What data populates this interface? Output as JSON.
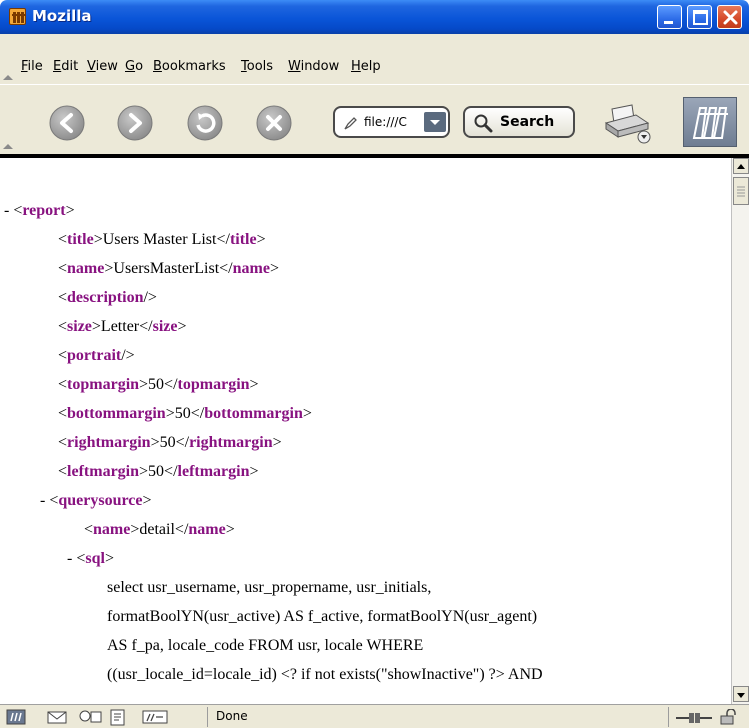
{
  "window": {
    "title": "Mozilla"
  },
  "menu": {
    "items": [
      {
        "pre": "",
        "acc": "F",
        "post": "ile"
      },
      {
        "pre": "",
        "acc": "E",
        "post": "dit"
      },
      {
        "pre": "",
        "acc": "V",
        "post": "iew"
      },
      {
        "pre": "",
        "acc": "G",
        "post": "o"
      },
      {
        "pre": "",
        "acc": "B",
        "post": "ookmarks"
      },
      {
        "pre": "",
        "acc": "T",
        "post": "ools"
      },
      {
        "pre": "",
        "acc": "W",
        "post": "indow"
      },
      {
        "pre": "",
        "acc": "H",
        "post": "elp"
      }
    ]
  },
  "toolbar": {
    "url_text": "file:///C",
    "search_label": "Search",
    "icons": [
      "back-icon",
      "forward-icon",
      "reload-icon",
      "stop-icon",
      "print-icon",
      "throbber-icon"
    ]
  },
  "content": {
    "lines": [
      {
        "parts": [
          {
            "t": "- <",
            "c": false
          },
          {
            "t": "report",
            "c": true
          },
          {
            "t": ">",
            "c": false
          }
        ]
      },
      {
        "parts": [
          {
            "t": "<",
            "c": false
          },
          {
            "t": "title",
            "c": true
          },
          {
            "t": ">Users Master List</",
            "c": false
          },
          {
            "t": "title",
            "c": true
          },
          {
            "t": ">",
            "c": false
          }
        ]
      },
      {
        "parts": [
          {
            "t": "<",
            "c": false
          },
          {
            "t": "name",
            "c": true
          },
          {
            "t": ">UsersMasterList</",
            "c": false
          },
          {
            "t": "name",
            "c": true
          },
          {
            "t": ">",
            "c": false
          }
        ]
      },
      {
        "parts": [
          {
            "t": "<",
            "c": false
          },
          {
            "t": "description",
            "c": true
          },
          {
            "t": "/>",
            "c": false
          }
        ]
      },
      {
        "parts": [
          {
            "t": "<",
            "c": false
          },
          {
            "t": "size",
            "c": true
          },
          {
            "t": ">Letter</",
            "c": false
          },
          {
            "t": "size",
            "c": true
          },
          {
            "t": ">",
            "c": false
          }
        ]
      },
      {
        "parts": [
          {
            "t": "<",
            "c": false
          },
          {
            "t": "portrait",
            "c": true
          },
          {
            "t": "/>",
            "c": false
          }
        ]
      },
      {
        "parts": [
          {
            "t": "<",
            "c": false
          },
          {
            "t": "topmargin",
            "c": true
          },
          {
            "t": ">50</",
            "c": false
          },
          {
            "t": "topmargin",
            "c": true
          },
          {
            "t": ">",
            "c": false
          }
        ]
      },
      {
        "parts": [
          {
            "t": "<",
            "c": false
          },
          {
            "t": "bottommargin",
            "c": true
          },
          {
            "t": ">50</",
            "c": false
          },
          {
            "t": "bottommargin",
            "c": true
          },
          {
            "t": ">",
            "c": false
          }
        ]
      },
      {
        "parts": [
          {
            "t": "<",
            "c": false
          },
          {
            "t": "rightmargin",
            "c": true
          },
          {
            "t": ">50</",
            "c": false
          },
          {
            "t": "rightmargin",
            "c": true
          },
          {
            "t": ">",
            "c": false
          }
        ]
      },
      {
        "parts": [
          {
            "t": "<",
            "c": false
          },
          {
            "t": "leftmargin",
            "c": true
          },
          {
            "t": ">50</",
            "c": false
          },
          {
            "t": "leftmargin",
            "c": true
          },
          {
            "t": ">",
            "c": false
          }
        ]
      },
      {
        "parts": [
          {
            "t": "- <",
            "c": false
          },
          {
            "t": "querysource",
            "c": true
          },
          {
            "t": ">",
            "c": false
          }
        ]
      },
      {
        "parts": [
          {
            "t": "<",
            "c": false
          },
          {
            "t": "name",
            "c": true
          },
          {
            "t": ">detail</",
            "c": false
          },
          {
            "t": "name",
            "c": true
          },
          {
            "t": ">",
            "c": false
          }
        ]
      },
      {
        "parts": [
          {
            "t": "- <",
            "c": false
          },
          {
            "t": "sql",
            "c": true
          },
          {
            "t": ">",
            "c": false
          }
        ]
      },
      {
        "parts": [
          {
            "t": "select usr_username, usr_propername, usr_initials,",
            "c": false
          }
        ]
      },
      {
        "parts": [
          {
            "t": "formatBoolYN(usr_active) AS f_active, formatBoolYN(usr_agent)",
            "c": false
          }
        ]
      },
      {
        "parts": [
          {
            "t": "AS f_pa, locale_code FROM usr, locale WHERE",
            "c": false
          }
        ]
      },
      {
        "parts": [
          {
            "t": "((usr_locale_id=locale_id) <? if not exists(\"showInactive\") ?> AND",
            "c": false
          }
        ]
      }
    ]
  },
  "status": {
    "text": "Done"
  }
}
